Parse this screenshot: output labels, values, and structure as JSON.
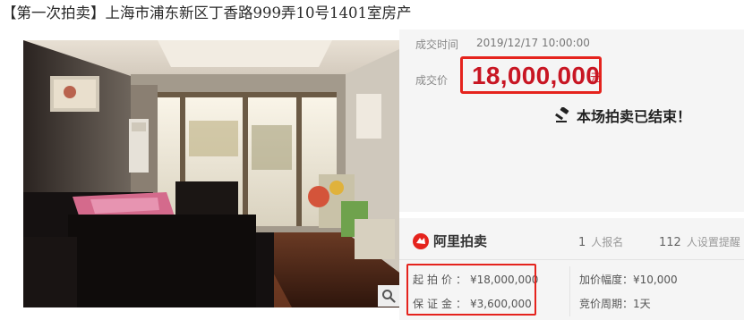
{
  "listing": {
    "title": "【第一次拍卖】上海市浦东新区丁香路999弄10号1401室房产"
  },
  "deal": {
    "time_label": "成交时间",
    "time_value": "2019/12/17 10:00:00",
    "price_label": "成交价",
    "price_value": "18,000,000",
    "price_unit": "元",
    "status_text": "本场拍卖已结束！"
  },
  "platform": {
    "name": "阿里拍卖",
    "signups_count": "1",
    "signups_label": "人报名",
    "reminders_count": "112",
    "reminders_label": "人设置提醒"
  },
  "terms": {
    "start_price_label": "起拍价：",
    "start_price_value": "¥18,000,000",
    "deposit_label": "保证金：",
    "deposit_value": "¥3,600,000",
    "increment_label": "加价幅度：",
    "increment_value": "¥10,000",
    "period_label": "竞价周期：",
    "period_value": "1天"
  },
  "colors": {
    "accent_red": "#e5231d",
    "price_red": "#c81623",
    "panel_bg": "#f5f5f5"
  },
  "icons": {
    "gavel": "gavel-icon",
    "zoom": "magnifier-icon",
    "logo": "alipaimai-logo"
  }
}
